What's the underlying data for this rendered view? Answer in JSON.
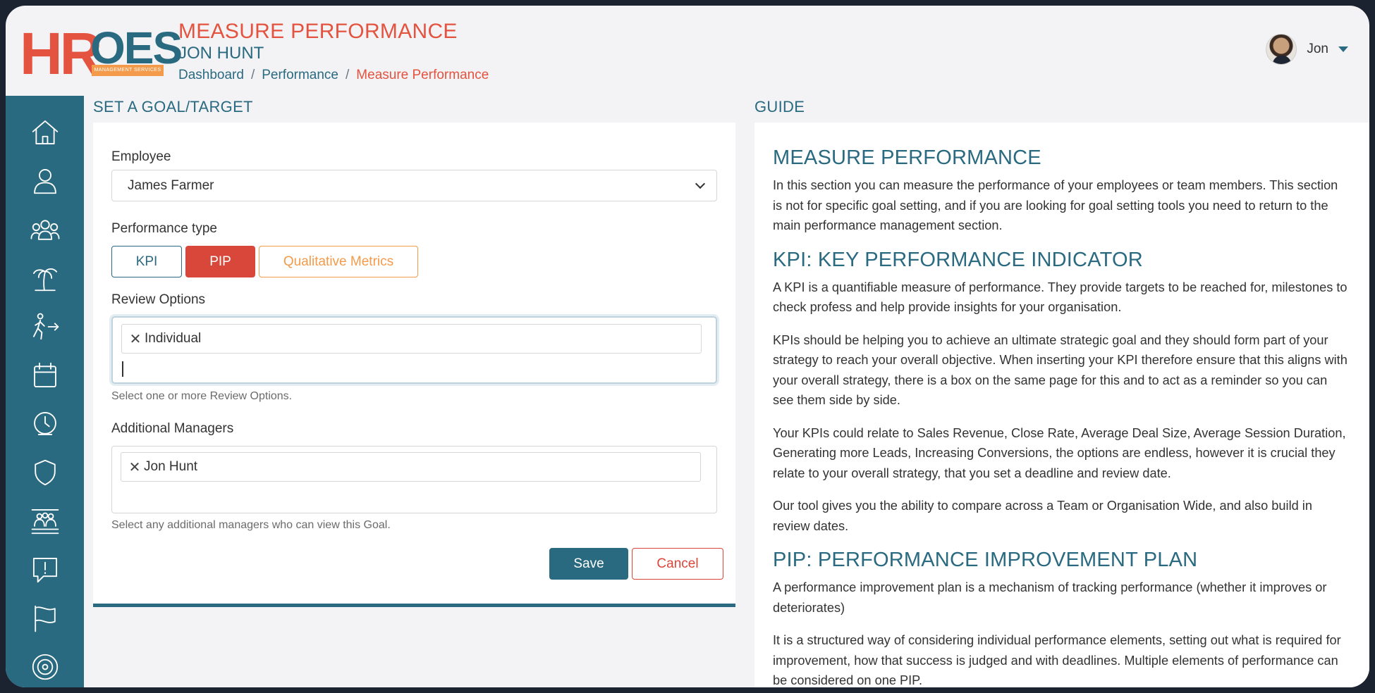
{
  "header": {
    "logo": {
      "primary": "HR",
      "secondary": "OES",
      "tagline": "MANAGEMENT SERVICES"
    },
    "page_title": "MEASURE PERFORMANCE",
    "subject_name": "JON HUNT",
    "breadcrumb": [
      "Dashboard",
      "Performance",
      "Measure Performance"
    ],
    "user": {
      "name": "Jon"
    }
  },
  "sidebar": {
    "items": [
      "home-icon",
      "user-icon",
      "team-icon",
      "holiday-icon",
      "leave-icon",
      "calendar-icon",
      "clock-icon",
      "shield-icon",
      "organisation-icon",
      "alert-icon",
      "flag-icon",
      "target-icon"
    ]
  },
  "form": {
    "heading": "SET A GOAL/TARGET",
    "employee_label": "Employee",
    "employee_value": "James Farmer",
    "performance_type_label": "Performance type",
    "performance_types": [
      "KPI",
      "PIP",
      "Qualitative Metrics"
    ],
    "selected_type": "PIP",
    "review_label": "Review Options",
    "review_selected": "Individual",
    "review_help": "Select one or more Review Options.",
    "managers_label": "Additional Managers",
    "managers_selected": "Jon Hunt",
    "managers_help": "Select any additional managers who can view this Goal.",
    "save_label": "Save",
    "cancel_label": "Cancel"
  },
  "guide": {
    "heading": "GUIDE",
    "sections": [
      {
        "title": "MEASURE PERFORMANCE",
        "paragraphs": [
          "In this section you can measure the performance of your employees or team members. This section is not for specific goal setting, and if you are looking for goal setting tools you need to return to the main performance management section."
        ]
      },
      {
        "title": "KPI: KEY PERFORMANCE INDICATOR",
        "paragraphs": [
          "A KPI is a quantifiable measure of performance. They provide targets to be reached for, milestones to check profess and help provide insights for your organisation.",
          "KPIs should be helping you to achieve an ultimate strategic goal and they should form part of your strategy to reach your overall objective. When inserting your KPI therefore ensure that this aligns with your overall strategy, there is a box on the same page for this and to act as a reminder so you can see them side by side.",
          "Your KPIs could relate to Sales Revenue, Close Rate, Average Deal Size, Average Session Duration, Generating more Leads, Increasing Conversions, the options are endless, however it is crucial they relate to your overall strategy, that you set a deadline and review date.",
          "Our tool gives you the ability to compare across a Team or Organisation Wide, and also build in review dates."
        ]
      },
      {
        "title": "PIP: PERFORMANCE IMPROVEMENT PLAN",
        "paragraphs": [
          "A performance improvement plan is a mechanism of tracking performance (whether it improves or deteriorates)",
          "It is a structured way of considering individual performance elements, setting out what is required for improvement, how that success is judged and with deadlines. Multiple elements of performance can be considered on one PIP."
        ]
      }
    ]
  },
  "colors": {
    "primary": "#2a6a80",
    "accent": "#e4533f",
    "danger": "#d9473a",
    "orange": "#f39b4a"
  }
}
